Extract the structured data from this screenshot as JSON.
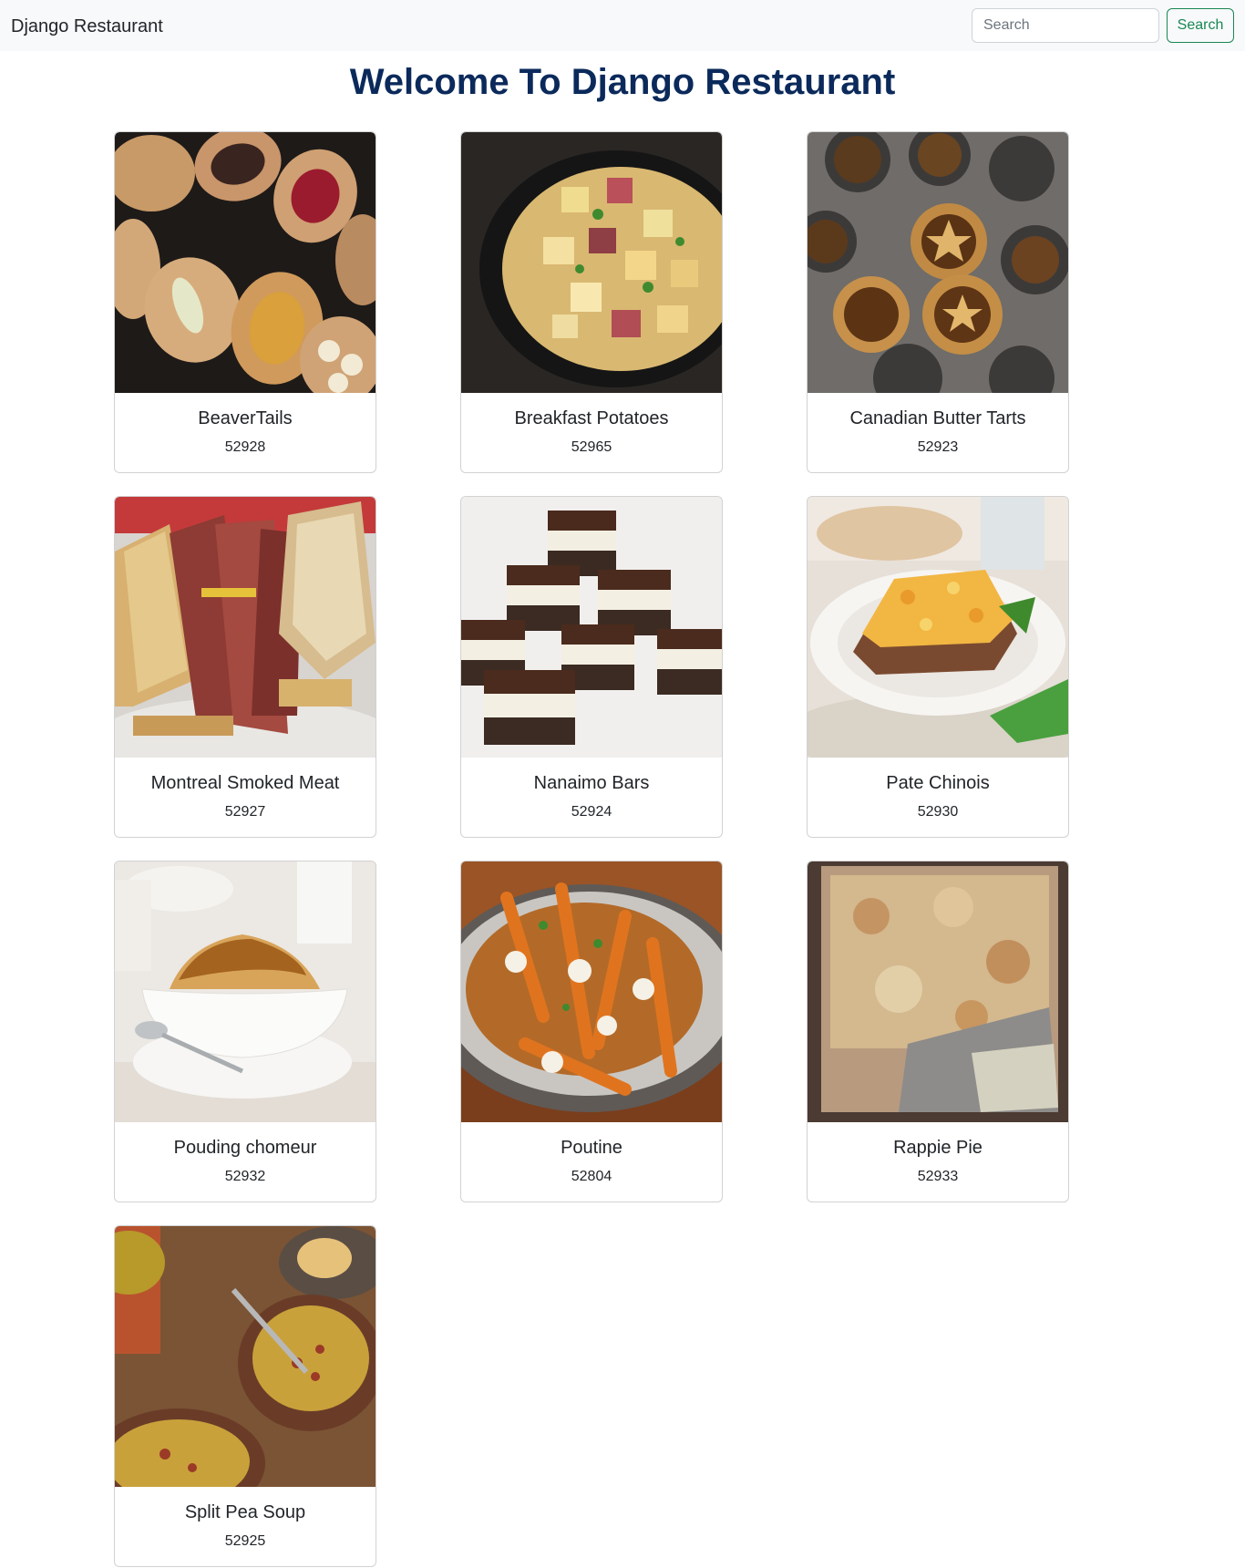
{
  "navbar": {
    "brand": "Django Restaurant",
    "search_placeholder": "Search",
    "search_button": "Search"
  },
  "page_title": "Welcome To Django Restaurant",
  "dishes": [
    {
      "name": "BeaverTails",
      "id": "52928",
      "icon": "beavertails-image"
    },
    {
      "name": "Breakfast Potatoes",
      "id": "52965",
      "icon": "breakfast-potatoes-image"
    },
    {
      "name": "Canadian Butter Tarts",
      "id": "52923",
      "icon": "butter-tarts-image"
    },
    {
      "name": "Montreal Smoked Meat",
      "id": "52927",
      "icon": "smoked-meat-image"
    },
    {
      "name": "Nanaimo Bars",
      "id": "52924",
      "icon": "nanaimo-bars-image"
    },
    {
      "name": "Pate Chinois",
      "id": "52930",
      "icon": "pate-chinois-image"
    },
    {
      "name": "Pouding chomeur",
      "id": "52932",
      "icon": "pouding-chomeur-image"
    },
    {
      "name": "Poutine",
      "id": "52804",
      "icon": "poutine-image"
    },
    {
      "name": "Rappie Pie",
      "id": "52933",
      "icon": "rappie-pie-image"
    },
    {
      "name": "Split Pea Soup",
      "id": "52925",
      "icon": "split-pea-soup-image"
    }
  ],
  "colors": {
    "navbar_bg": "#f8f9fa",
    "title": "#0b2a5b",
    "search_accent": "#198754"
  }
}
